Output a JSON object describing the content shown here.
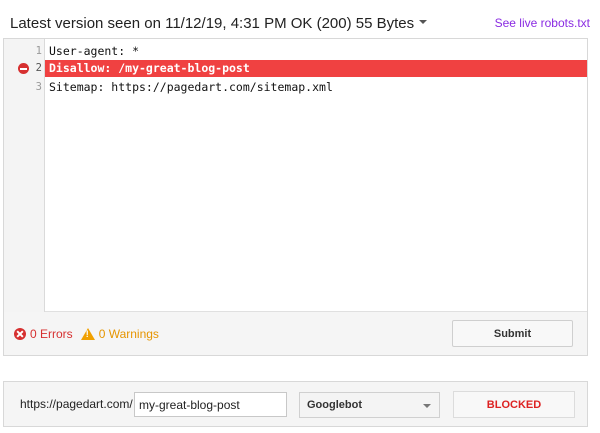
{
  "header": {
    "version_label": "Latest version seen on 11/12/19, 4:31 PM OK (200) 55 Bytes",
    "live_link": "See live robots.txt"
  },
  "editor": {
    "lines": [
      {
        "num": "1",
        "text": "User-agent: *",
        "error": false
      },
      {
        "num": "2",
        "text": "Disallow: /my-great-blog-post",
        "error": true
      },
      {
        "num": "3",
        "text": "Sitemap: https://pagedart.com/sitemap.xml",
        "error": false
      }
    ]
  },
  "status": {
    "errors_label": "0 Errors",
    "warnings_label": "0 Warnings",
    "submit_label": "Submit"
  },
  "test": {
    "url_prefix": "https://pagedart.com/",
    "url_value": "my-great-blog-post",
    "agent_selected": "Googlebot",
    "result": "BLOCKED"
  },
  "colors": {
    "error_line": "#f04141",
    "error_text": "#d63030",
    "warning_text": "#e69500",
    "blocked_text": "#dd2222",
    "link": "#8a2be2"
  },
  "icons": {
    "error_marker": "error-marker-icon",
    "errors": "x-circle-icon",
    "warnings": "warning-triangle-icon",
    "dropdown": "caret-down-icon"
  }
}
